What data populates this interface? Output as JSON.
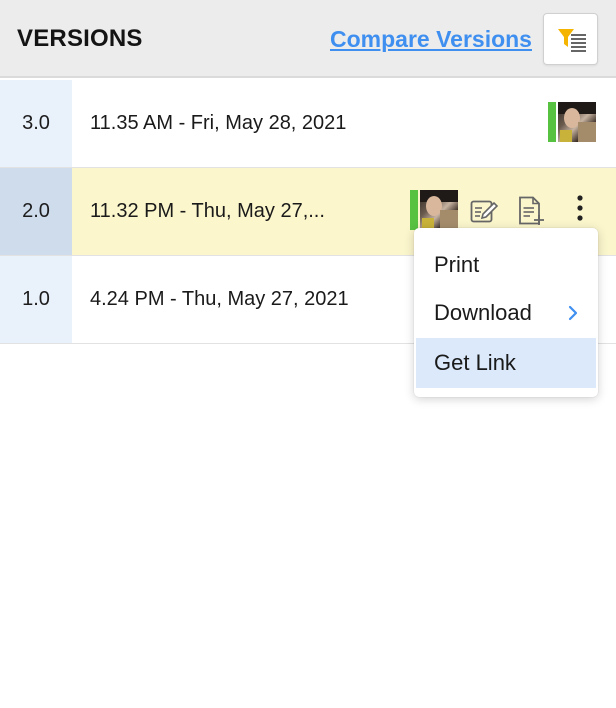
{
  "header": {
    "title": "VERSIONS",
    "compare_label": "Compare Versions",
    "filter_icon": "filter-list-icon"
  },
  "versions": [
    {
      "version": "3.0",
      "timestamp": "11.35 AM - Fri, May 28, 2021",
      "selected": false
    },
    {
      "version": "2.0",
      "timestamp": "11.32 PM - Thu, May 27,...",
      "selected": true
    },
    {
      "version": "1.0",
      "timestamp": "4.24 PM - Thu, May 27, 2021",
      "selected": false
    }
  ],
  "row_actions": {
    "edit_icon": "edit-icon",
    "restore_icon": "document-add-icon",
    "more_icon": "more-vertical-icon"
  },
  "context_menu": {
    "items": [
      {
        "label": "Print"
      },
      {
        "label": "Download",
        "submenu": true
      },
      {
        "label": "Get Link",
        "highlighted": true
      }
    ]
  },
  "colors": {
    "accent_link": "#3f8ff0",
    "selected_row": "#fbf6cc",
    "version_cell": "#e9f1fb",
    "avatar_status": "#57c242",
    "menu_highlight": "#dbe9fb"
  }
}
